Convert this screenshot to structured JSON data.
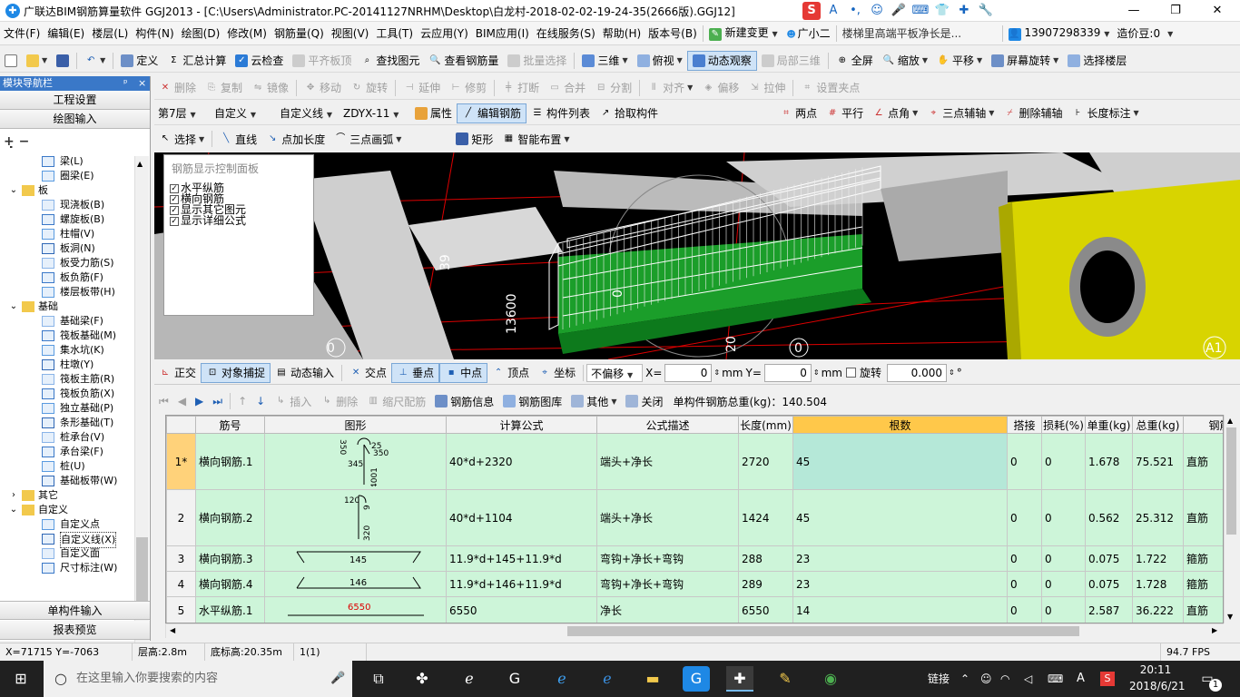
{
  "window": {
    "title": "广联达BIM钢筋算量软件 GGJ2013 - [C:\\Users\\Administrator.PC-20141127NRHM\\Desktop\\白龙村-2018-02-02-19-24-35(2666版).GGJ12]",
    "controls": {
      "minimize": "—",
      "maximize": "❐",
      "close": "✕"
    },
    "ime_icons": [
      "S",
      "A",
      "•,",
      "☺",
      "🎤",
      "⌨",
      "👕",
      "✚",
      "🔧"
    ]
  },
  "menu": {
    "items": [
      "文件(F)",
      "编辑(E)",
      "楼层(L)",
      "构件(N)",
      "绘图(D)",
      "修改(M)",
      "钢筋量(Q)",
      "视图(V)",
      "工具(T)",
      "云应用(Y)",
      "BIM应用(I)",
      "在线服务(S)",
      "帮助(H)",
      "版本号(B)"
    ],
    "new_change": "新建变更",
    "assistant": "广小二",
    "question": "楼梯里高端平板净长是...",
    "phone": "13907298339",
    "bean": "造价豆:0"
  },
  "toolbar1": {
    "items": [
      "定义",
      "汇总计算",
      "云检查",
      "平齐板顶",
      "查找图元",
      "查看钢筋量",
      "批量选择",
      "三维",
      "俯视",
      "动态观察",
      "局部三维",
      "全屏",
      "缩放",
      "平移",
      "屏幕旋转",
      "选择楼层"
    ]
  },
  "toolbar2": {
    "items": [
      "删除",
      "复制",
      "镜像",
      "移动",
      "旋转",
      "延伸",
      "修剪",
      "打断",
      "合并",
      "分割",
      "对齐",
      "偏移",
      "拉伸",
      "设置夹点"
    ]
  },
  "toolbar3": {
    "floor": "第7层",
    "type": "自定义",
    "subtype": "自定义线",
    "code": "ZDYX-11",
    "items": [
      "属性",
      "编辑钢筋",
      "构件列表",
      "拾取构件"
    ],
    "right_items": [
      "两点",
      "平行",
      "点角",
      "三点辅轴",
      "删除辅轴",
      "长度标注"
    ]
  },
  "toolbar4": {
    "items": [
      "选择",
      "直线",
      "点加长度",
      "三点画弧",
      "矩形",
      "智能布置"
    ]
  },
  "nav": {
    "title": "模块导航栏",
    "pin": "ᵖ",
    "close": "×",
    "btn_settings": "工程设置",
    "btn_draw": "绘图输入",
    "btn_single": "单构件输入",
    "btn_report": "报表预览",
    "tree": [
      {
        "label": "梁(L)",
        "indent": 2,
        "icon": "beam-icon"
      },
      {
        "label": "圈梁(E)",
        "indent": 2,
        "icon": "ring-beam-icon"
      },
      {
        "label": "板",
        "indent": 1,
        "folder": true,
        "expanded": true
      },
      {
        "label": "现浇板(B)",
        "indent": 2,
        "icon": "slab-icon"
      },
      {
        "label": "螺旋板(B)",
        "indent": 2,
        "icon": "spiral-slab-icon"
      },
      {
        "label": "柱帽(V)",
        "indent": 2,
        "icon": "column-cap-icon"
      },
      {
        "label": "板洞(N)",
        "indent": 2,
        "icon": "slab-hole-icon"
      },
      {
        "label": "板受力筋(S)",
        "indent": 2,
        "icon": "slab-rebar-icon"
      },
      {
        "label": "板负筋(F)",
        "indent": 2,
        "icon": "slab-neg-rebar-icon"
      },
      {
        "label": "楼层板带(H)",
        "indent": 2,
        "icon": "floor-strip-icon"
      },
      {
        "label": "基础",
        "indent": 1,
        "folder": true,
        "expanded": true
      },
      {
        "label": "基础梁(F)",
        "indent": 2,
        "icon": "foundation-beam-icon"
      },
      {
        "label": "筏板基础(M)",
        "indent": 2,
        "icon": "raft-icon"
      },
      {
        "label": "集水坑(K)",
        "indent": 2,
        "icon": "sump-icon"
      },
      {
        "label": "柱墩(Y)",
        "indent": 2,
        "icon": "pier-icon"
      },
      {
        "label": "筏板主筋(R)",
        "indent": 2,
        "icon": "raft-main-rebar-icon"
      },
      {
        "label": "筏板负筋(X)",
        "indent": 2,
        "icon": "raft-neg-rebar-icon"
      },
      {
        "label": "独立基础(P)",
        "indent": 2,
        "icon": "isolated-footing-icon"
      },
      {
        "label": "条形基础(T)",
        "indent": 2,
        "icon": "strip-footing-icon"
      },
      {
        "label": "桩承台(V)",
        "indent": 2,
        "icon": "pile-cap-icon"
      },
      {
        "label": "承台梁(F)",
        "indent": 2,
        "icon": "cap-beam-icon"
      },
      {
        "label": "桩(U)",
        "indent": 2,
        "icon": "pile-icon"
      },
      {
        "label": "基础板带(W)",
        "indent": 2,
        "icon": "foundation-strip-icon"
      },
      {
        "label": "其它",
        "indent": 1,
        "folder": true,
        "expanded": false
      },
      {
        "label": "自定义",
        "indent": 1,
        "folder": true,
        "expanded": true
      },
      {
        "label": "自定义点",
        "indent": 2,
        "icon": "custom-point-icon"
      },
      {
        "label": "自定义线(X)",
        "indent": 2,
        "icon": "custom-line-icon",
        "selected": true
      },
      {
        "label": "自定义面",
        "indent": 2,
        "icon": "custom-face-icon"
      },
      {
        "label": "尺寸标注(W)",
        "indent": 2,
        "icon": "dimension-icon"
      }
    ]
  },
  "viewport": {
    "panel_title": "钢筋显示控制面板",
    "checkboxes": [
      "水平纵筋",
      "横向钢筋",
      "显示其它图元",
      "显示详细公式"
    ],
    "labels": [
      "39",
      "13600",
      "0",
      "0",
      "20",
      "0",
      "A1"
    ]
  },
  "snap": {
    "items": [
      "正交",
      "对象捕捉",
      "动态输入",
      "交点",
      "垂点",
      "中点",
      "顶点",
      "坐标"
    ],
    "offset_mode": "不偏移",
    "x_label": "X=",
    "x_value": "0",
    "y_label": "Y=",
    "y_value": "0",
    "unit": "mm",
    "rotate_label": "旋转",
    "rotate_value": "0.000",
    "degree": "°"
  },
  "tablebar": {
    "items": [
      "插入",
      "删除",
      "缩尺配筋",
      "钢筋信息",
      "钢筋图库",
      "其他",
      "关闭"
    ],
    "total": "单构件钢筋总重(kg)：140.504"
  },
  "grid": {
    "columns": [
      "",
      "筋号",
      "图形",
      "计算公式",
      "公式描述",
      "长度(mm)",
      "根数",
      "搭接",
      "损耗(%)",
      "单重(kg)",
      "总重(kg)",
      "钢筋"
    ],
    "rows": [
      {
        "rn": "1*",
        "name": "横向钢筋.1",
        "shape_text": "350 | 345 | 350 | 4001 | 25",
        "formula": "40*d+2320",
        "desc": "端头+净长",
        "length": "2720",
        "count": "45",
        "lap": "0",
        "loss": "0",
        "unit_w": "1.678",
        "total_w": "75.521",
        "kind": "直筋"
      },
      {
        "rn": "2",
        "name": "横向钢筋.2",
        "shape_text": "120 | 320 | 5 | 9",
        "formula": "40*d+1104",
        "desc": "端头+净长",
        "length": "1424",
        "count": "45",
        "lap": "0",
        "loss": "0",
        "unit_w": "0.562",
        "total_w": "25.312",
        "kind": "直筋"
      },
      {
        "rn": "3",
        "name": "横向钢筋.3",
        "shape_text": "145",
        "formula": "11.9*d+145+11.9*d",
        "desc": "弯钩+净长+弯钩",
        "length": "288",
        "count": "23",
        "lap": "0",
        "loss": "0",
        "unit_w": "0.075",
        "total_w": "1.722",
        "kind": "箍筋"
      },
      {
        "rn": "4",
        "name": "横向钢筋.4",
        "shape_text": "146",
        "formula": "11.9*d+146+11.9*d",
        "desc": "弯钩+净长+弯钩",
        "length": "289",
        "count": "23",
        "lap": "0",
        "loss": "0",
        "unit_w": "0.075",
        "total_w": "1.728",
        "kind": "箍筋"
      },
      {
        "rn": "5",
        "name": "水平纵筋.1",
        "shape_text": "6550",
        "formula": "6550",
        "desc": "净长",
        "length": "6550",
        "count": "14",
        "lap": "0",
        "loss": "0",
        "unit_w": "2.587",
        "total_w": "36.222",
        "kind": "直筋"
      }
    ]
  },
  "status": {
    "coords": "X=71715 Y=-7063",
    "floor_h": "层高:2.8m",
    "bottom_h": "底标高:20.35m",
    "count": "1(1)",
    "fps": "94.7 FPS"
  },
  "taskbar": {
    "search_placeholder": "在这里输入你要搜索的内容",
    "tray_text": "链接",
    "time": "20:11",
    "date": "2018/6/21",
    "ime_a": "A",
    "notif": "1"
  },
  "colors": {
    "accent": "#3a78c8",
    "grid_row": "#cdf5d9",
    "header_highlight": "#ffc84a",
    "rebar_green": "#1b9e2a",
    "column_yellow": "#d8d400"
  }
}
